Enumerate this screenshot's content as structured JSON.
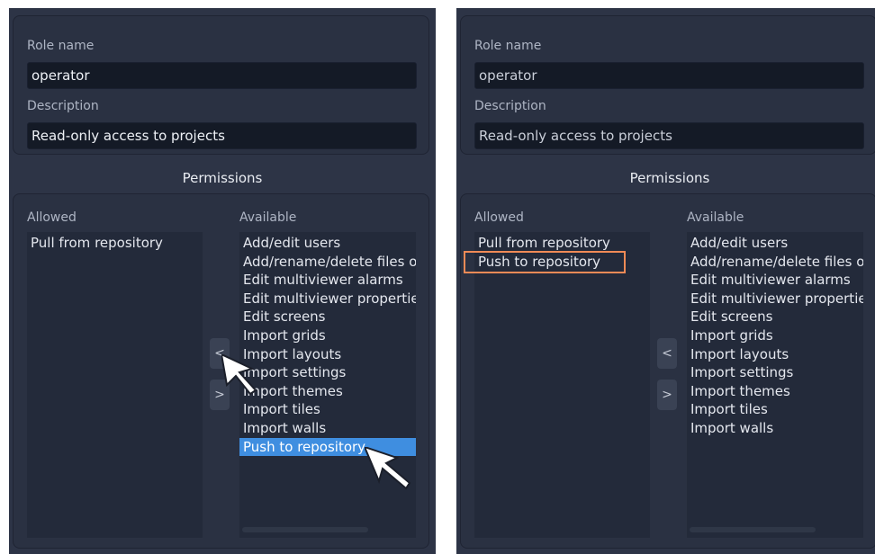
{
  "left_panel": {
    "role_name_label": "Role name",
    "role_name_value": "operator",
    "description_label": "Description",
    "description_value": "Read-only access to projects",
    "permissions_title": "Permissions",
    "allowed_label": "Allowed",
    "available_label": "Available",
    "allowed_items": [
      "Pull from repository"
    ],
    "available_items": [
      "Add/edit users",
      "Add/rename/delete files o",
      "Edit multiviewer alarms",
      "Edit multiviewer properties",
      "Edit screens",
      "Import grids",
      "Import layouts",
      "Import settings",
      "Import themes",
      "Import tiles",
      "Import walls",
      "Push to repository"
    ],
    "selected_available": "Push to repository",
    "move_left_button": "<",
    "move_right_button": ">"
  },
  "right_panel": {
    "role_name_label": "Role name",
    "role_name_value": "operator",
    "description_label": "Description",
    "description_value": "Read-only access to projects",
    "permissions_title": "Permissions",
    "allowed_label": "Allowed",
    "available_label": "Available",
    "allowed_items": [
      "Pull from repository",
      "Push to repository"
    ],
    "highlighted_allowed": "Push to repository",
    "available_items": [
      "Add/edit users",
      "Add/rename/delete files o",
      "Edit multiviewer alarms",
      "Edit multiviewer properties",
      "Edit screens",
      "Import grids",
      "Import layouts",
      "Import settings",
      "Import themes",
      "Import tiles",
      "Import walls"
    ],
    "move_left_button": "<",
    "move_right_button": ">"
  },
  "colors": {
    "panel_bg": "#2d3446",
    "field_bg": "#141a26",
    "selection": "#3f8ee0",
    "highlight_outline": "#f08a56"
  },
  "icons": {
    "cursor": "mouse-pointer-arrow-icon"
  }
}
